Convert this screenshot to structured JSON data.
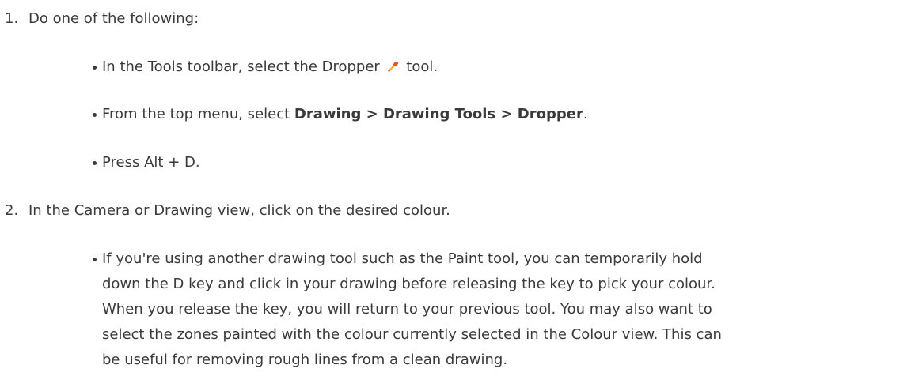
{
  "step1": {
    "number": "1.",
    "text": "Do one of the following:"
  },
  "bullets1": [
    {
      "before": "In the Tools toolbar, select the Dropper",
      "icon": "dropper-icon",
      "after": "tool."
    },
    {
      "prefix": "From the top menu, select ",
      "bold": "Drawing > Drawing Tools > Dropper",
      "suffix": "."
    },
    {
      "text": "Press Alt + D."
    }
  ],
  "step2": {
    "number": "2.",
    "text": "In the Camera or Drawing view, click on the desired colour."
  },
  "bullets2": [
    {
      "lines": [
        "If you're using another drawing tool such as the Paint tool, you can temporarily hold",
        "down the D key and click in your drawing before releasing the key to pick your colour.",
        "When you release the key, you will return to your previous tool. You may also want to",
        "select the zones painted with the colour currently selected in the Colour view. This can",
        "be useful for removing rough lines from a clean drawing."
      ]
    }
  ],
  "colors": {
    "text": "#3a3a3a",
    "dropper_tip": "#e8502a",
    "dropper_body": "#f6a623"
  }
}
